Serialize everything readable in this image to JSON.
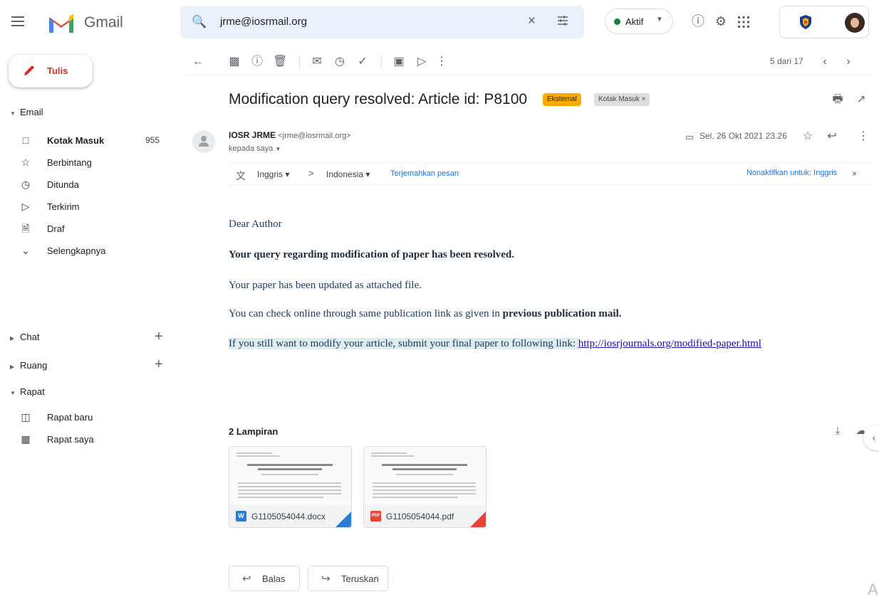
{
  "app": {
    "name": "Gmail"
  },
  "search": {
    "query": "jrme@iosrmail.org"
  },
  "status": {
    "label": "Aktif",
    "color": "#188038"
  },
  "header_icons": [
    "help-icon",
    "settings-icon",
    "apps-grid-icon"
  ],
  "compose": {
    "label": "Tulis",
    "color": "#d93025"
  },
  "sidebar": {
    "email_section": "Email",
    "items": [
      {
        "label": "Kotak Masuk",
        "count": "955",
        "icon": "inbox-icon"
      },
      {
        "label": "Berbintang",
        "icon": "star-icon"
      },
      {
        "label": "Ditunda",
        "icon": "clock-icon"
      },
      {
        "label": "Terkirim",
        "icon": "send-icon"
      },
      {
        "label": "Draf",
        "icon": "draft-icon"
      },
      {
        "label": "Selengkapnya",
        "icon": "chevron-down-icon"
      }
    ],
    "chat_section": "Chat",
    "spaces_section": "Ruang",
    "meet_section": "Rapat",
    "meet_items": [
      {
        "label": "Rapat baru",
        "icon": "video-plus-icon"
      },
      {
        "label": "Rapat saya",
        "icon": "calendar-icon"
      }
    ]
  },
  "toolbar": {
    "pager": "5 dari 17"
  },
  "email": {
    "subject": "Modification query resolved: Article id: P8100",
    "badge_external": "Eksternal",
    "badge_inbox": "Kotak Masuk ×",
    "sender_name": "IOSR JRME",
    "sender_address": "<jrme@iosrmail.org>",
    "to": "kepada saya",
    "date": "Sel, 26 Okt 2021 23.26"
  },
  "translate": {
    "source": "Inggris",
    "target": "Indonesia",
    "action": "Terjemahkan pesan",
    "disable": "Nonaktifkan untuk: Inggris"
  },
  "body": {
    "greeting": "Dear Author",
    "line1": "Your query regarding modification of paper has been resolved.",
    "line2": "Your paper has been updated as attached file.",
    "line3_prefix": "You can check online through same publication link as given in ",
    "line3_bold": "previous publication mail.",
    "line4_prefix": "If you still want to modify your article, submit your final paper to following link: ",
    "line4_link": "http://iosrjournals.org/modified-paper.html"
  },
  "attachments": {
    "title": "2 Lampiran",
    "files": [
      {
        "name": "G1105054044.docx",
        "type": "W",
        "color": "#2b7cd3"
      },
      {
        "name": "G1105054044.pdf",
        "type": "PDF",
        "color": "#ea4335"
      }
    ]
  },
  "reply": {
    "reply_label": "Balas",
    "forward_label": "Teruskan"
  }
}
